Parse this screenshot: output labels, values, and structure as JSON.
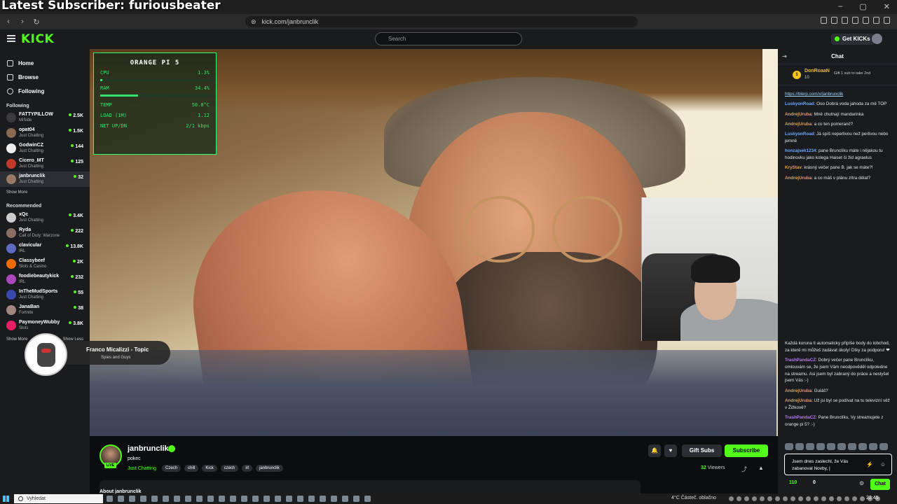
{
  "overlay": {
    "title": "Latest Subscriber: furiousbeater"
  },
  "browser": {
    "url": "kick.com/janbrunclik"
  },
  "header": {
    "search_placeholder": "Search",
    "get_kicks": "Get KICKs"
  },
  "sidebar": {
    "nav": [
      {
        "label": "Home"
      },
      {
        "label": "Browse"
      },
      {
        "label": "Following"
      }
    ],
    "following_title": "Following",
    "following": [
      {
        "name": "FATTYPILLOW",
        "category": "MiSide",
        "viewers": "2.5K"
      },
      {
        "name": "opat04",
        "category": "Just Chatting",
        "viewers": "1.5K"
      },
      {
        "name": "GodwinCZ",
        "category": "Just Chatting",
        "viewers": "144"
      },
      {
        "name": "Cicero_MT",
        "category": "Just Chatting",
        "viewers": "125"
      },
      {
        "name": "janbrunclik",
        "category": "Just Chatting",
        "viewers": "32"
      }
    ],
    "show_more": "Show More",
    "recommended_title": "Recommended",
    "recommended": [
      {
        "name": "xQc",
        "category": "Just Chatting",
        "viewers": "3.4K"
      },
      {
        "name": "Ryda",
        "category": "Call of Duty: Warzone",
        "viewers": "222"
      },
      {
        "name": "clavicular",
        "category": "IRL",
        "viewers": "13.8K"
      },
      {
        "name": "Classybeef",
        "category": "Slots & Casino",
        "viewers": "2K"
      },
      {
        "name": "foodiebeautykick",
        "category": "IRL",
        "viewers": "232"
      },
      {
        "name": "InTheMudSports",
        "category": "Just Chatting",
        "viewers": "55"
      },
      {
        "name": "JanaBan",
        "category": "Fortnite",
        "viewers": "38"
      },
      {
        "name": "PaymoneyWubby",
        "category": "Slots",
        "viewers": "3.8K"
      }
    ],
    "show_more_bottom": "Show More",
    "show_less": "Show Less"
  },
  "media": {
    "title": "Franco Micalizzi - Topic",
    "artist": "Spies and Guys"
  },
  "stats_overlay": {
    "title": "ORANGE PI 5",
    "rows": [
      {
        "label": "CPU",
        "value": "1.3%"
      },
      {
        "label": "RAM",
        "value": "34.4%"
      },
      {
        "label": "TEMP",
        "value": "50.8°C"
      },
      {
        "label": "LOAD (1M)",
        "value": "1.12"
      },
      {
        "label": "NET UP/DN",
        "value": "2/1 kbps"
      }
    ],
    "cpu_level": 0.013,
    "ram_level": 0.344
  },
  "stream": {
    "channel": "janbrunclik",
    "title": "pokec",
    "category": "Just Chatting",
    "tags": [
      "Czech",
      "chill",
      "Kick",
      "czech",
      "irl",
      "janbrunclik"
    ],
    "live": "LIVE",
    "gift_subs": "Gift Subs",
    "subscribe": "Subscribe",
    "viewers": "32",
    "viewers_label": "Viewers",
    "about": "About janbrunclik"
  },
  "chat": {
    "title": "Chat",
    "pinned": {
      "user": "DonRoaaN",
      "badge": "10",
      "coin": "1",
      "message": "Gift 1 sub to take 2nd"
    },
    "messages": [
      {
        "user": "",
        "text": "https://blerp.com/x/janbrunclik",
        "color": "#9fd6ff",
        "link": true
      },
      {
        "user": "LuskyonRoad",
        "text": "Ooo Dobrá voda jahoda za mě TOP",
        "color": "#6fa8ff"
      },
      {
        "user": "AndrejUruba",
        "text": "Mně chutnají mandarinka",
        "color": "#e6a23c"
      },
      {
        "user": "AndrejUruba",
        "text": "a co ten pomeranč?",
        "color": "#e6a23c"
      },
      {
        "user": "LuskyonRoad",
        "text": "Já spíš neperlivou než perlivou nebo jemně",
        "color": "#6fa8ff"
      },
      {
        "user": "honzajsek1234",
        "text": "pane Brunclíku máte i nějakou tu hodinovku jako kolega Haiset či žid agraelus",
        "color": "#6fa8ff"
      },
      {
        "user": "KryStav",
        "text": "krásný večer pane B. jak se máte?!",
        "color": "#e6a23c"
      },
      {
        "user": "AndrejUruba",
        "text": "a co máš v plánu zítra dělat?",
        "color": "#e6a23c"
      }
    ],
    "messages2": [
      {
        "user": "",
        "text": "Každá koruna ti automaticky připíše body do lobchod, za které mi můžeš zadávat úkoly! Díky za podporu! ❤",
        "color": "#e6e6e6"
      },
      {
        "user": "TrashPandaCZ",
        "text": "Dobrý večer pane Brunclíku, omlouvám se, že jsem Vám neodpověděl odpoledne na streamu. Asi jsem byl zabraný do práce a neslyšel jsem Vás :-)",
        "color": "#b779ff"
      },
      {
        "user": "AndrejUruba",
        "text": "Guláš?",
        "color": "#e6a23c"
      },
      {
        "user": "AndrejUruba",
        "text": "Už jsi byl se podívat na tu televizní věž v Žižkově?",
        "color": "#e6a23c"
      },
      {
        "user": "TrashPandaCZ",
        "text": "Pane Brunclíku, Vy streamujete z orange pi 5? :-)",
        "color": "#b779ff"
      }
    ],
    "input_text": "Jsem dnes zaslechl, že Vás zabanoval Novby, |",
    "points": "110",
    "gifts": "0",
    "send": "Chat"
  },
  "taskbar": {
    "search": "Vyhledat",
    "weather": "4°C  Částeč. oblačno",
    "time": "22:45"
  },
  "colors": {
    "accent": "#53fc18",
    "background": "#0b0e0f",
    "panel": "#191b1f"
  }
}
